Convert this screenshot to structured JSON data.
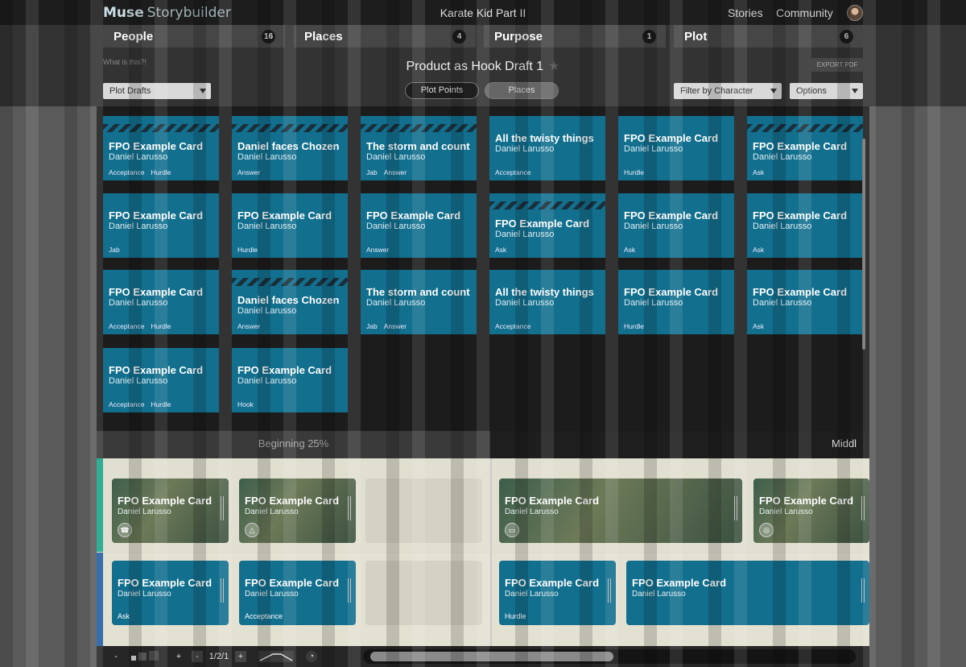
{
  "app": {
    "brand": "Muse",
    "subbrand": "Storybuilder",
    "story_title": "Karate Kid Part II",
    "nav": [
      "Stories",
      "Community"
    ]
  },
  "tabs": [
    {
      "label": "People",
      "count": "16"
    },
    {
      "label": "Places",
      "count": "4"
    },
    {
      "label": "Purpose",
      "count": "1"
    },
    {
      "label": "Plot",
      "count": "6"
    }
  ],
  "header": {
    "what_is_this": "What is this?!",
    "draft_title": "Product as Hook Draft 1",
    "star_icon": "star-icon",
    "export": "EXPORT PDF",
    "plot_drafts": "Plot Drafts",
    "toggle_plot_points": "Plot Points",
    "toggle_places": "Places",
    "filter": "Filter by Character",
    "options": "Options"
  },
  "board": [
    {
      "title": "FPO Example Card",
      "sub": "Daniel Larusso",
      "tags": [
        "Acceptance",
        "Hurdle"
      ],
      "striped": true
    },
    {
      "title": "Daniel faces Chozen",
      "sub": "Daniel Larusso",
      "tags": [
        "Answer"
      ],
      "striped": true
    },
    {
      "title": "The storm and count",
      "sub": "Daniel Larusso",
      "tags": [
        "Jab",
        "Answer"
      ],
      "striped": true
    },
    {
      "title": "All the twisty things",
      "sub": "Daniel Larusso",
      "tags": [
        "Acceptance"
      ],
      "striped": false
    },
    {
      "title": "FPO Example Card",
      "sub": "Daniel Larusso",
      "tags": [
        "Hurdle"
      ],
      "striped": false
    },
    {
      "title": "FPO Example Card",
      "sub": "Daniel Larusso",
      "tags": [
        "Ask"
      ],
      "striped": true
    },
    {
      "title": "FPO Example Card",
      "sub": "Daniel Larusso",
      "tags": [
        "Jab"
      ],
      "striped": false
    },
    {
      "title": "FPO Example Card",
      "sub": "Daniel Larusso",
      "tags": [
        "Hurdle"
      ],
      "striped": false
    },
    {
      "title": "FPO Example Card",
      "sub": "Daniel Larusso",
      "tags": [
        "Answer"
      ],
      "striped": false
    },
    {
      "title": "FPO Example Card",
      "sub": "Daniel Larusso",
      "tags": [
        "Ask"
      ],
      "striped": true
    },
    {
      "title": "FPO Example Card",
      "sub": "Daniel Larusso",
      "tags": [
        "Ask"
      ],
      "striped": false
    },
    {
      "title": "FPO Example Card",
      "sub": "Daniel Larusso",
      "tags": [
        "Ask"
      ],
      "striped": false
    },
    {
      "title": "FPO Example Card",
      "sub": "Daniel Larusso",
      "tags": [
        "Acceptance",
        "Hurdle"
      ],
      "striped": false
    },
    {
      "title": "Daniel faces Chozen",
      "sub": "Daniel Larusso",
      "tags": [
        "Answer"
      ],
      "striped": true
    },
    {
      "title": "The storm and count",
      "sub": "Daniel Larusso",
      "tags": [
        "Jab",
        "Answer"
      ],
      "striped": false
    },
    {
      "title": "All the twisty things",
      "sub": "Daniel Larusso",
      "tags": [
        "Acceptance"
      ],
      "striped": false
    },
    {
      "title": "FPO Example Card",
      "sub": "Daniel Larusso",
      "tags": [
        "Hurdle"
      ],
      "striped": false
    },
    {
      "title": "FPO Example Card",
      "sub": "Daniel Larusso",
      "tags": [
        "Ask"
      ],
      "striped": false
    },
    {
      "title": "FPO Example Card",
      "sub": "Daniel Larusso",
      "tags": [
        "Acceptance",
        "Hurdle"
      ],
      "striped": false
    },
    {
      "title": "FPO Example Card",
      "sub": "Daniel Larusso",
      "tags": [
        "Hook"
      ],
      "striped": false
    }
  ],
  "acts": {
    "act1": "Beginning 25%",
    "act2": "Middl"
  },
  "timeline": {
    "lane1": [
      {
        "title": "FPO Example Card",
        "sub": "Daniel Larusso",
        "icon": "☎"
      },
      {
        "title": "FPO Example Card",
        "sub": "Daniel Larusso",
        "icon": "△"
      },
      {
        "title": "FPO Example Card",
        "sub": "Daniel Larusso",
        "icon": "▭"
      },
      {
        "title": "FPO Example Card",
        "sub": "Daniel Larusso",
        "icon": "◎"
      }
    ],
    "lane2": [
      {
        "title": "FPO Example Card",
        "sub": "Daniel Larusso",
        "tag": "Ask"
      },
      {
        "title": "FPO Example Card",
        "sub": "Daniel Larusso",
        "tag": "Acceptance"
      },
      {
        "title": "FPO Example Card",
        "sub": "Daniel Larusso",
        "tag": "Hurdle"
      },
      {
        "title": "FPO Example Card",
        "sub": "Daniel Larusso",
        "tag": ""
      }
    ]
  },
  "bottom": {
    "minus": "-",
    "plus": "+",
    "zoom_minus": "-",
    "zoom_label": "1/2/1",
    "zoom_plus": "+"
  },
  "colors": {
    "card": "#126f8e",
    "lane1_marker": "#18a58a",
    "lane2_marker": "#1f5fa3"
  }
}
